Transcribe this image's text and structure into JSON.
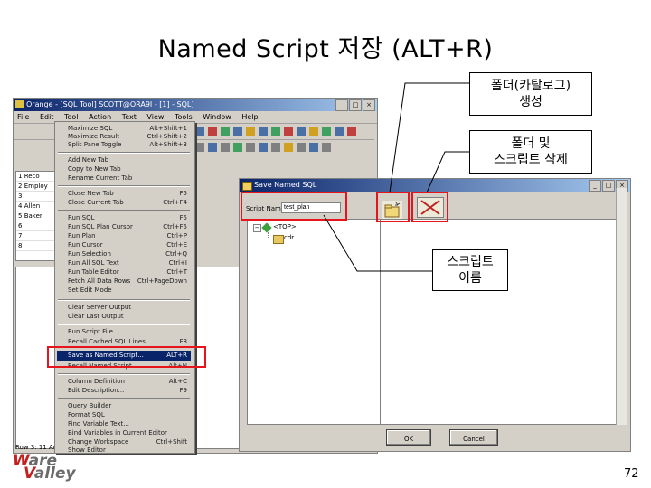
{
  "slide": {
    "title": "Named Script 저장 (ALT+R)",
    "page_number": "72",
    "logo": {
      "line1": "Ware",
      "line2": "Valley",
      "tagline": "Everywhere IT Services"
    }
  },
  "callouts": {
    "create_folder": "폴더(카탈로그)\n생성",
    "delete": "폴더 및\n스크립트 삭제",
    "script_name": "스크립트\n이름"
  },
  "app": {
    "title": "Orange - [SQL Tool] SCOTT@ORA9I - [1] - SQL]",
    "menus": [
      "File",
      "Edit",
      "Tool",
      "Action",
      "Text",
      "View",
      "Tools",
      "Window",
      "Help"
    ],
    "grid_rows": [
      "1",
      "2",
      "3",
      "4",
      "5",
      "6",
      "7",
      "8"
    ],
    "grid_words": [
      "Reco",
      "Employ",
      "Allen",
      "Baker"
    ],
    "status": "Row 3: 11 Active"
  },
  "menu": {
    "items": [
      {
        "label": "Maximize SQL",
        "shortcut": "Alt+Shift+1"
      },
      {
        "label": "Maximize Result",
        "shortcut": "Ctrl+Shift+2"
      },
      {
        "label": "Split Pane Toggle",
        "shortcut": "Alt+Shift+3"
      },
      {
        "label": "Add New Tab",
        "shortcut": ""
      },
      {
        "label": "Copy to New Tab",
        "shortcut": ""
      },
      {
        "label": "Rename Current Tab",
        "shortcut": ""
      },
      {
        "label": "Close New Tab",
        "shortcut": "F5"
      },
      {
        "label": "Close Current Tab",
        "shortcut": "Ctrl+F4"
      },
      {
        "label": "Run SQL",
        "shortcut": "F5"
      },
      {
        "label": "Run SQL Plan Cursor",
        "shortcut": "Ctrl+F5"
      },
      {
        "label": "Run Plan",
        "shortcut": "Ctrl+P"
      },
      {
        "label": "Run Cursor",
        "shortcut": "Ctrl+E"
      },
      {
        "label": "Run Selection",
        "shortcut": "Ctrl+Q"
      },
      {
        "label": "Run All SQL Text",
        "shortcut": "Ctrl+I"
      },
      {
        "label": "Run Table Editor",
        "shortcut": "Ctrl+T"
      },
      {
        "label": "Fetch All Data Rows",
        "shortcut": "Ctrl+PageDown"
      },
      {
        "label": "Set Edit Mode",
        "shortcut": ""
      },
      {
        "label": "Clear Server Output",
        "shortcut": ""
      },
      {
        "label": "Clear Last Output",
        "shortcut": ""
      },
      {
        "label": "Run Script File...",
        "shortcut": ""
      },
      {
        "label": "Recall Cached SQL Lines...",
        "shortcut": "F8"
      },
      {
        "label": "Save as Named Script...",
        "shortcut": "Alt+R"
      },
      {
        "label": "Recall Named Script...",
        "shortcut": "Alt+N"
      },
      {
        "label": "Column Definition",
        "shortcut": "Alt+C"
      },
      {
        "label": "Edit Description...",
        "shortcut": "F9"
      },
      {
        "label": "Query Builder",
        "shortcut": ""
      },
      {
        "label": "Format SQL",
        "shortcut": ""
      },
      {
        "label": "Find Variable Text...",
        "shortcut": ""
      },
      {
        "label": "Bind Variables in Current Editor",
        "shortcut": ""
      },
      {
        "label": "Change Workspace",
        "shortcut": "Ctrl+Shift"
      },
      {
        "label": "Show Editor",
        "shortcut": ""
      }
    ],
    "highlighted": "Save as Named Script...",
    "highlighted_shortcut": "ALT+R"
  },
  "dialog": {
    "title": "Save Named SQL",
    "script_name_label": "Script Name:",
    "script_name_value": "test_plan",
    "tree_root": "<TOP>",
    "tree_child": "cdr",
    "ok": "OK",
    "cancel": "Cancel"
  }
}
